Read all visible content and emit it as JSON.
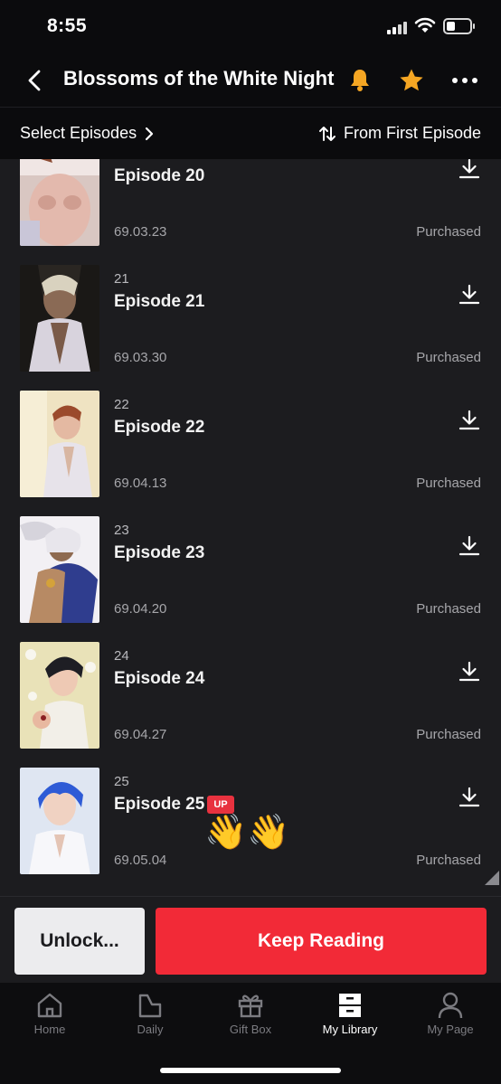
{
  "status_bar": {
    "time": "8:55"
  },
  "header": {
    "title": "Blossoms of the White Night"
  },
  "subbar": {
    "select_label": "Select Episodes",
    "sort_label": "From First Episode"
  },
  "episodes": [
    {
      "number": "",
      "title": "Episode 20",
      "date": "69.03.23",
      "status": "Purchased",
      "badge": ""
    },
    {
      "number": "21",
      "title": "Episode 21",
      "date": "69.03.30",
      "status": "Purchased",
      "badge": ""
    },
    {
      "number": "22",
      "title": "Episode 22",
      "date": "69.04.13",
      "status": "Purchased",
      "badge": ""
    },
    {
      "number": "23",
      "title": "Episode 23",
      "date": "69.04.20",
      "status": "Purchased",
      "badge": ""
    },
    {
      "number": "24",
      "title": "Episode 24",
      "date": "69.04.27",
      "status": "Purchased",
      "badge": ""
    },
    {
      "number": "25",
      "title": "Episode 25",
      "date": "69.05.04",
      "status": "Purchased",
      "badge": "UP"
    }
  ],
  "emoji": "👋👋",
  "actions": {
    "unlock_label": "Unlock...",
    "keep_reading_label": "Keep Reading"
  },
  "tabs": [
    {
      "label": "Home",
      "icon": "home-icon",
      "active": false
    },
    {
      "label": "Daily",
      "icon": "daily-icon",
      "active": false
    },
    {
      "label": "Gift Box",
      "icon": "gift-icon",
      "active": false
    },
    {
      "label": "My Library",
      "icon": "library-icon",
      "active": true
    },
    {
      "label": "My Page",
      "icon": "person-icon",
      "active": false
    }
  ],
  "colors": {
    "accent": "#f22a37",
    "star": "#f5a623",
    "bell": "#f5a623",
    "background": "#1c1c1f"
  }
}
